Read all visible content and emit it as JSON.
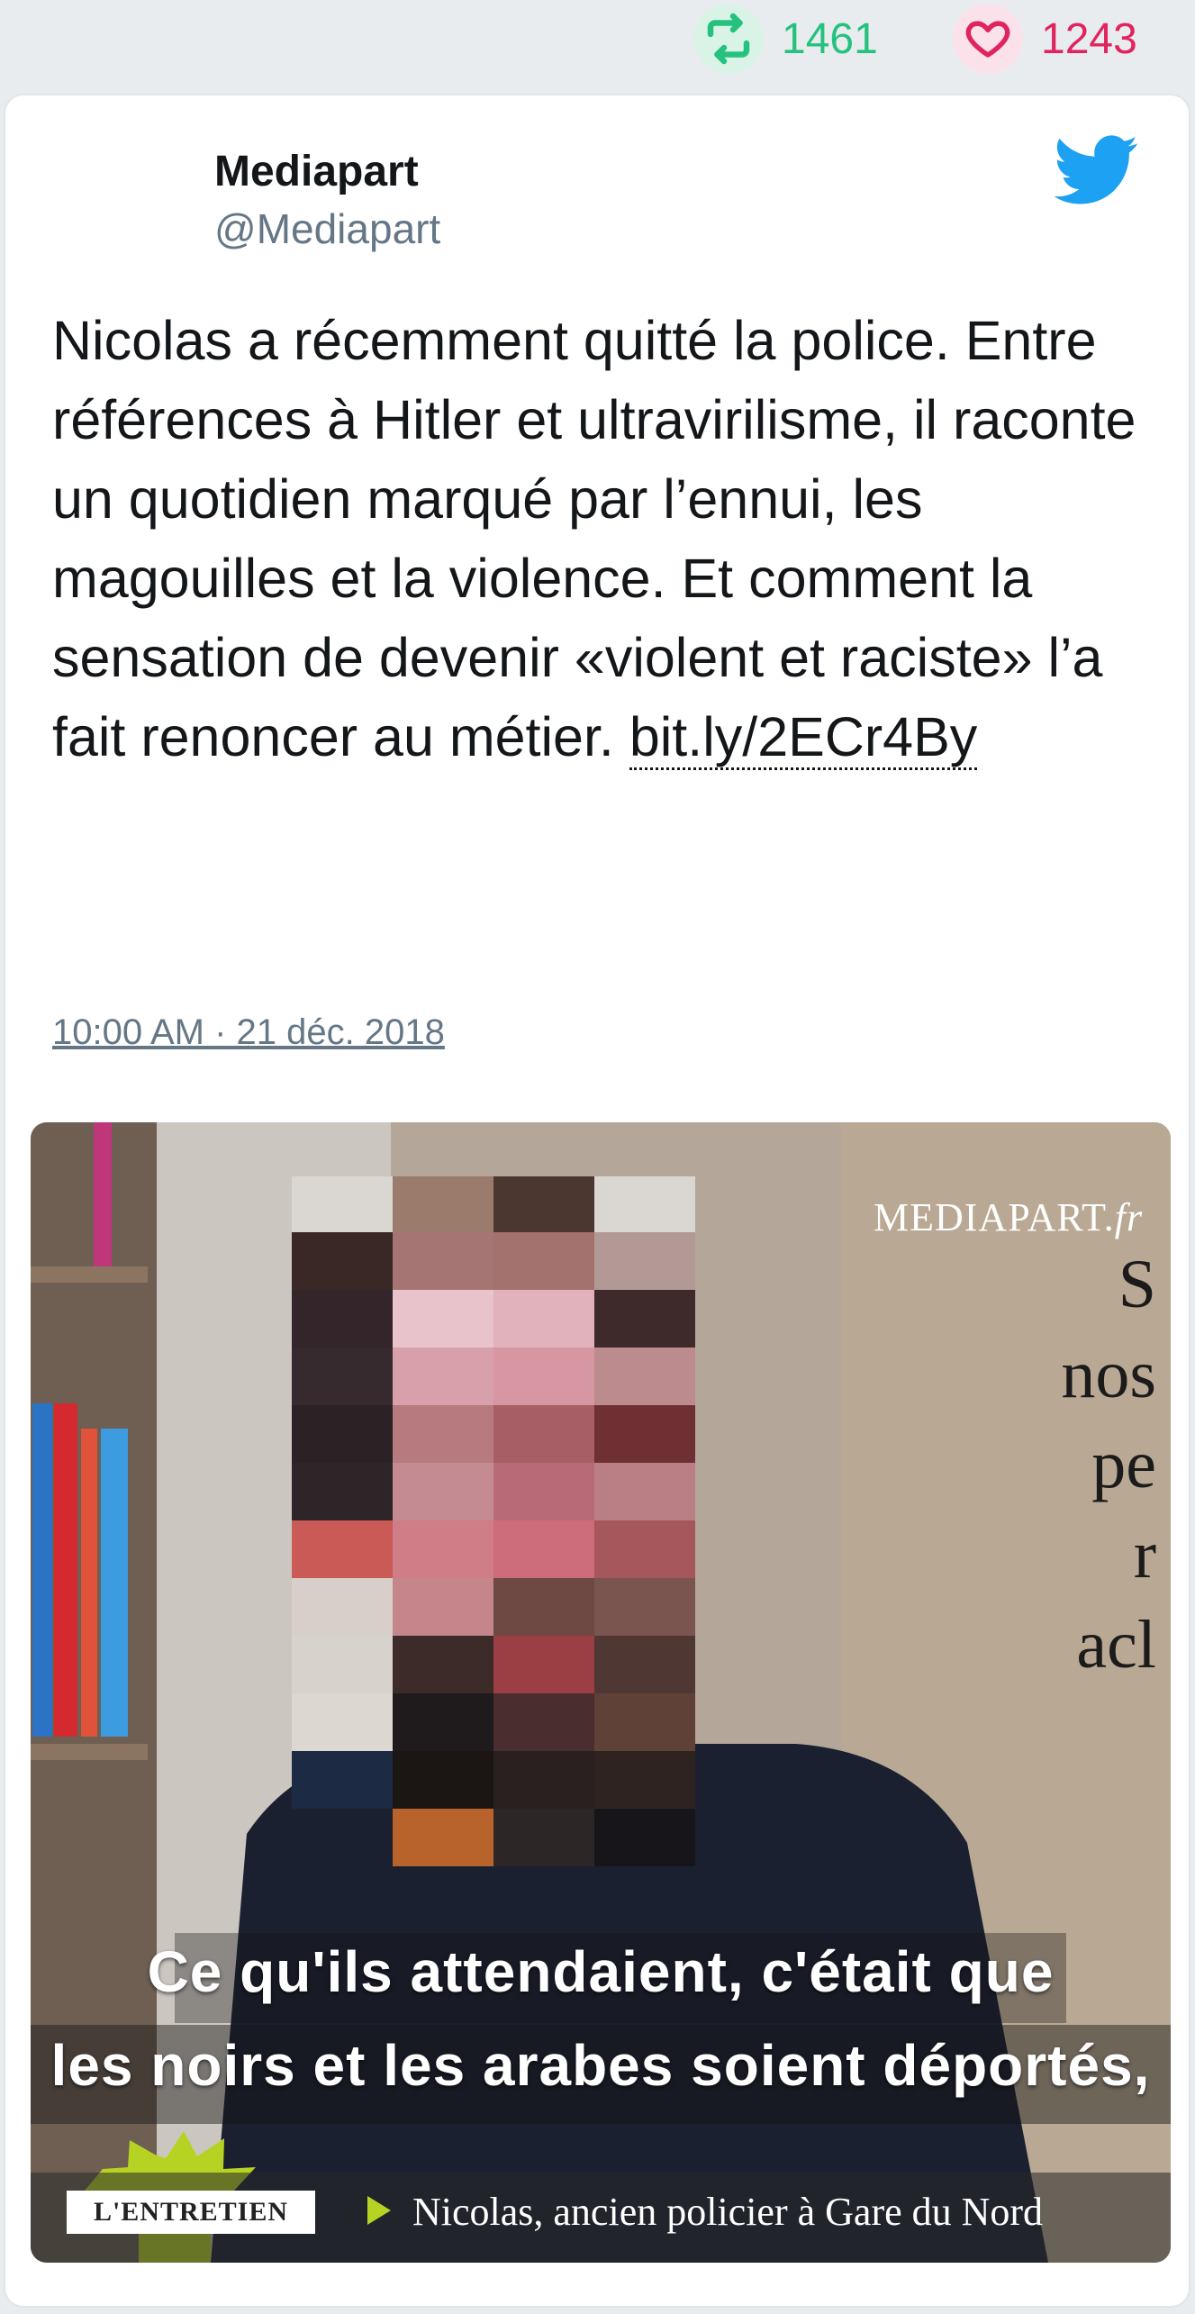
{
  "stats": {
    "retweets": "1461",
    "likes": "1243",
    "retweet_color": "#25c27e",
    "like_color": "#e0245e"
  },
  "tweet": {
    "author_name": "Mediapart",
    "author_handle": "@Mediapart",
    "text": "Nicolas a récemment quitté la police. Entre références à Hitler et ultravirilisme, il raconte un quotidien marqué par l’ennui, les magouilles et la violence. Et comment la sensation de devenir «violent et raciste» l’a fait renoncer au métier. ",
    "link": "bit.ly/2ECr4By",
    "timestamp": "10:00 AM · 21 déc. 2018",
    "icons": [
      "twitter-bird-icon",
      "reply-icon",
      "retweet-icon",
      "like-icon"
    ]
  },
  "media": {
    "brand_main": "MEDIAPART.",
    "brand_suffix": "fr",
    "background_words": [
      "S",
      "nos",
      "pe",
      "r",
      "acl"
    ],
    "subtitle_line1": "Ce qu'ils attendaient, c'était que",
    "subtitle_line2": "les noirs et les arabes soient déportés,",
    "show_label": "L'ENTRETIEN",
    "caption": "Nicolas, ancien policier à Gare du Nord"
  }
}
